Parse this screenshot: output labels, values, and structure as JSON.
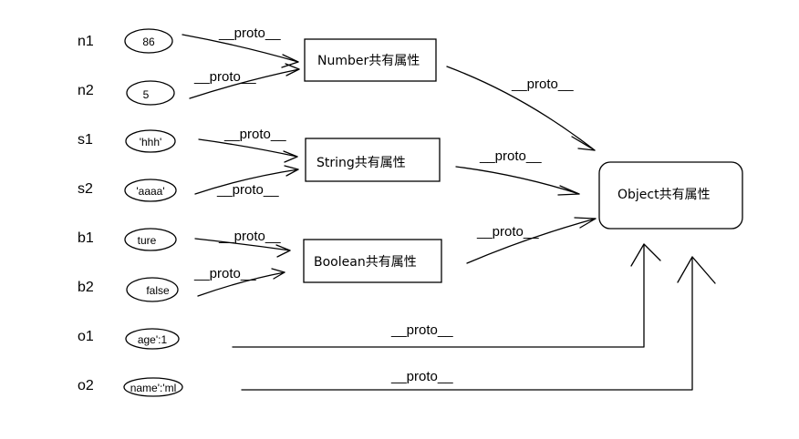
{
  "variables": [
    {
      "id": "n1",
      "name": "n1",
      "value": "86"
    },
    {
      "id": "n2",
      "name": "n2",
      "value": "5"
    },
    {
      "id": "s1",
      "name": "s1",
      "value": "'hhh'"
    },
    {
      "id": "s2",
      "name": "s2",
      "value": "'aaaa'"
    },
    {
      "id": "b1",
      "name": "b1",
      "value": "ture"
    },
    {
      "id": "b2",
      "name": "b2",
      "value": "false"
    },
    {
      "id": "o1",
      "name": "o1",
      "value": "age':1"
    },
    {
      "id": "o2",
      "name": "o2",
      "value": "name':'ml"
    }
  ],
  "boxes": {
    "number": "Number共有属性",
    "string": "String共有属性",
    "boolean": "Boolean共有属性",
    "object": "Object共有属性"
  },
  "arrow_label": "__proto__"
}
